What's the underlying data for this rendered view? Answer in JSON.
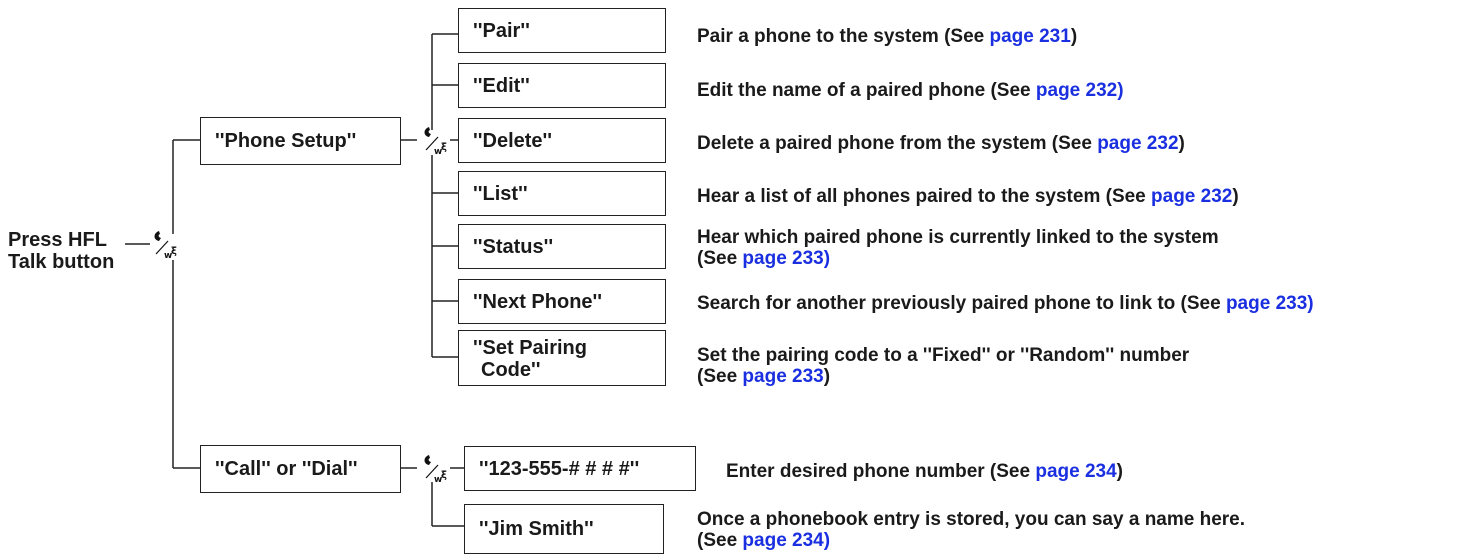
{
  "root": {
    "line1": "Press HFL",
    "line2": "Talk button"
  },
  "level1": [
    {
      "label": "''Phone Setup''"
    },
    {
      "label": "''Call'' or ''Dial''"
    }
  ],
  "phone_setup_options": [
    {
      "label": "''Pair''",
      "desc_prefix": "Pair a phone to the system  (See ",
      "link": "page 231",
      "desc_suffix": ")"
    },
    {
      "label": "''Edit''",
      "desc_prefix": "Edit the name of a paired phone (See ",
      "link": "page 232)",
      "desc_suffix": ""
    },
    {
      "label": "''Delete''",
      "desc_prefix": "Delete a paired phone from the system (See ",
      "link": "page 232",
      "desc_suffix": ")"
    },
    {
      "label": "''List''",
      "desc_prefix": "Hear a list of all phones paired to the system (See ",
      "link": "page 232",
      "desc_suffix": ")"
    },
    {
      "label": "''Status''",
      "desc_line1": "Hear which paired phone is currently linked to the system",
      "desc_prefix": "(See ",
      "link": "page 233)",
      "desc_suffix": ""
    },
    {
      "label": "''Next Phone''",
      "desc_prefix": "Search for another previously paired phone to link to (See ",
      "link": "page 233)",
      "desc_suffix": ""
    },
    {
      "label_line1": "''Set Pairing",
      "label_line2": "Code''",
      "desc_line1": "Set the pairing code to a ''Fixed'' or ''Random'' number",
      "desc_prefix": "(See ",
      "link": "page 233",
      "desc_suffix": ")"
    }
  ],
  "call_options": [
    {
      "label": "''123-555-# # # #''",
      "desc_prefix": "Enter desired phone number  (See ",
      "link": "page 234",
      "desc_suffix": ")"
    },
    {
      "label": "''Jim Smith''",
      "desc_line1": "Once a phonebook entry is stored, you can say a name here.",
      "desc_prefix": "(See ",
      "link": "page 234)",
      "desc_suffix": ""
    }
  ],
  "icons": {
    "talk": "talk-voice-icon"
  },
  "colors": {
    "link": "#1a2fe0",
    "text": "#1a1a1a"
  }
}
